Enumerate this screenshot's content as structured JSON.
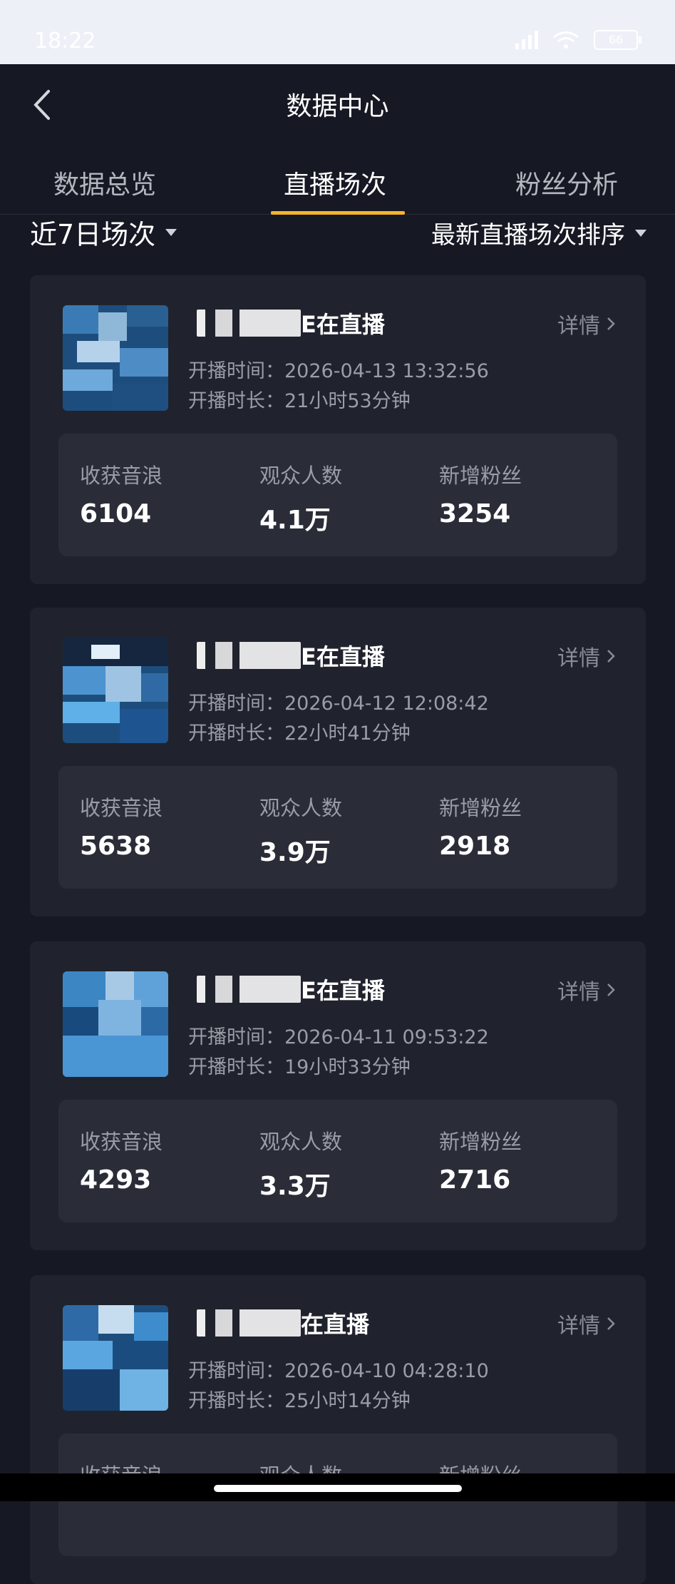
{
  "status_bar": {
    "time": "18:22",
    "battery": "66"
  },
  "nav": {
    "title": "数据中心"
  },
  "tabs": [
    {
      "label": "数据总览"
    },
    {
      "label": "直播场次"
    },
    {
      "label": "粉丝分析"
    }
  ],
  "filters": {
    "range": "近7日场次",
    "sort": "最新直播场次排序"
  },
  "labels": {
    "detail": "详情",
    "start_time": "开播时间：",
    "duration": "开播时长：",
    "income": "收获音浪",
    "viewers": "观众人数",
    "new_fans": "新增粉丝"
  },
  "sessions": [
    {
      "name": "E在直播",
      "start_time": "2026-04-13 13:32:56",
      "duration": "21小时53分钟",
      "income": "6104",
      "viewers": "4.1万",
      "new_fans": "3254"
    },
    {
      "name": "E在直播",
      "start_time": "2026-04-12 12:08:42",
      "duration": "22小时41分钟",
      "income": "5638",
      "viewers": "3.9万",
      "new_fans": "2918"
    },
    {
      "name": "E在直播",
      "start_time": "2026-04-11 09:53:22",
      "duration": "19小时33分钟",
      "income": "4293",
      "viewers": "3.3万",
      "new_fans": "2716"
    },
    {
      "name": "在直播",
      "start_time": "2026-04-10 04:28:10",
      "duration": "25小时14分钟",
      "income": "",
      "viewers": "",
      "new_fans": ""
    }
  ]
}
